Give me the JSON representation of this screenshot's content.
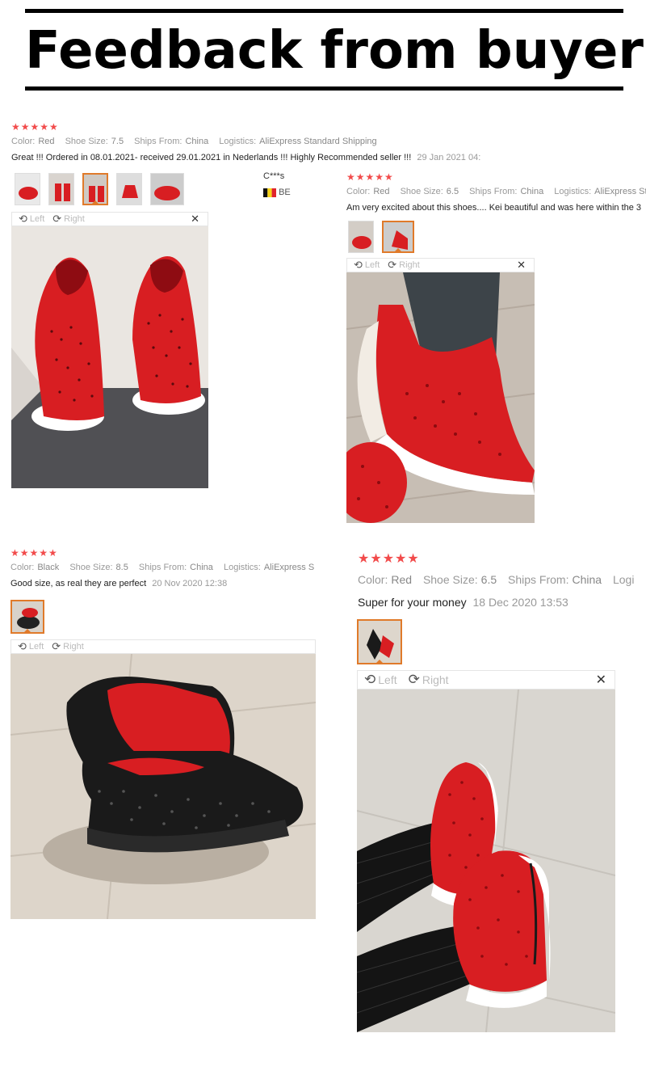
{
  "banner": {
    "title": "Feedback from buyers"
  },
  "reviews": [
    {
      "stars": "★★★★★",
      "color_label": "Color:",
      "color": "Red",
      "size_label": "Shoe Size:",
      "size": "7.5",
      "ships_label": "Ships From:",
      "ships": "China",
      "logistics_label": "Logistics:",
      "logistics": "AliExpress Standard Shipping",
      "text": "Great !!! Ordered in 08.01.2021- received 29.01.2021 in Nederlands !!! Highly Recommended seller !!!",
      "date": "29 Jan 2021 04:",
      "buyer": "C***s",
      "country": "BE",
      "toolbar": {
        "left": "Left",
        "right": "Right"
      }
    },
    {
      "stars": "★★★★★",
      "color_label": "Color:",
      "color": "Red",
      "size_label": "Shoe Size:",
      "size": "6.5",
      "ships_label": "Ships From:",
      "ships": "China",
      "logistics_label": "Logistics:",
      "logistics": "AliExpress Stand",
      "text": "Am very excited about this shoes.... Kei beautiful and was here within the 3",
      "toolbar": {
        "left": "Left",
        "right": "Right"
      }
    },
    {
      "stars": "★★★★★",
      "color_label": "Color:",
      "color": "Black",
      "size_label": "Shoe Size:",
      "size": "8.5",
      "ships_label": "Ships From:",
      "ships": "China",
      "logistics_label": "Logistics:",
      "logistics": "AliExpress S",
      "text": "Good size, as real they are perfect",
      "date": "20 Nov 2020 12:38",
      "toolbar": {
        "left": "Left",
        "right": "Right"
      }
    },
    {
      "stars": "★★★★★",
      "color_label": "Color:",
      "color": "Red",
      "size_label": "Shoe Size:",
      "size": "6.5",
      "ships_label": "Ships From:",
      "ships": "China",
      "logistics_label": "Logi",
      "text": "Super for your money",
      "date": "18 Dec 2020 13:53",
      "toolbar": {
        "left": "Left",
        "right": "Right"
      }
    }
  ],
  "icons": {
    "rotate_left": "rotate-left-icon",
    "rotate_right": "rotate-right-icon",
    "close": "close-icon",
    "flag": "belgium-flag-icon"
  },
  "colors": {
    "star": "#f24b4b",
    "active_thumb": "#e07a2a",
    "shoe_red": "#d81e22"
  }
}
